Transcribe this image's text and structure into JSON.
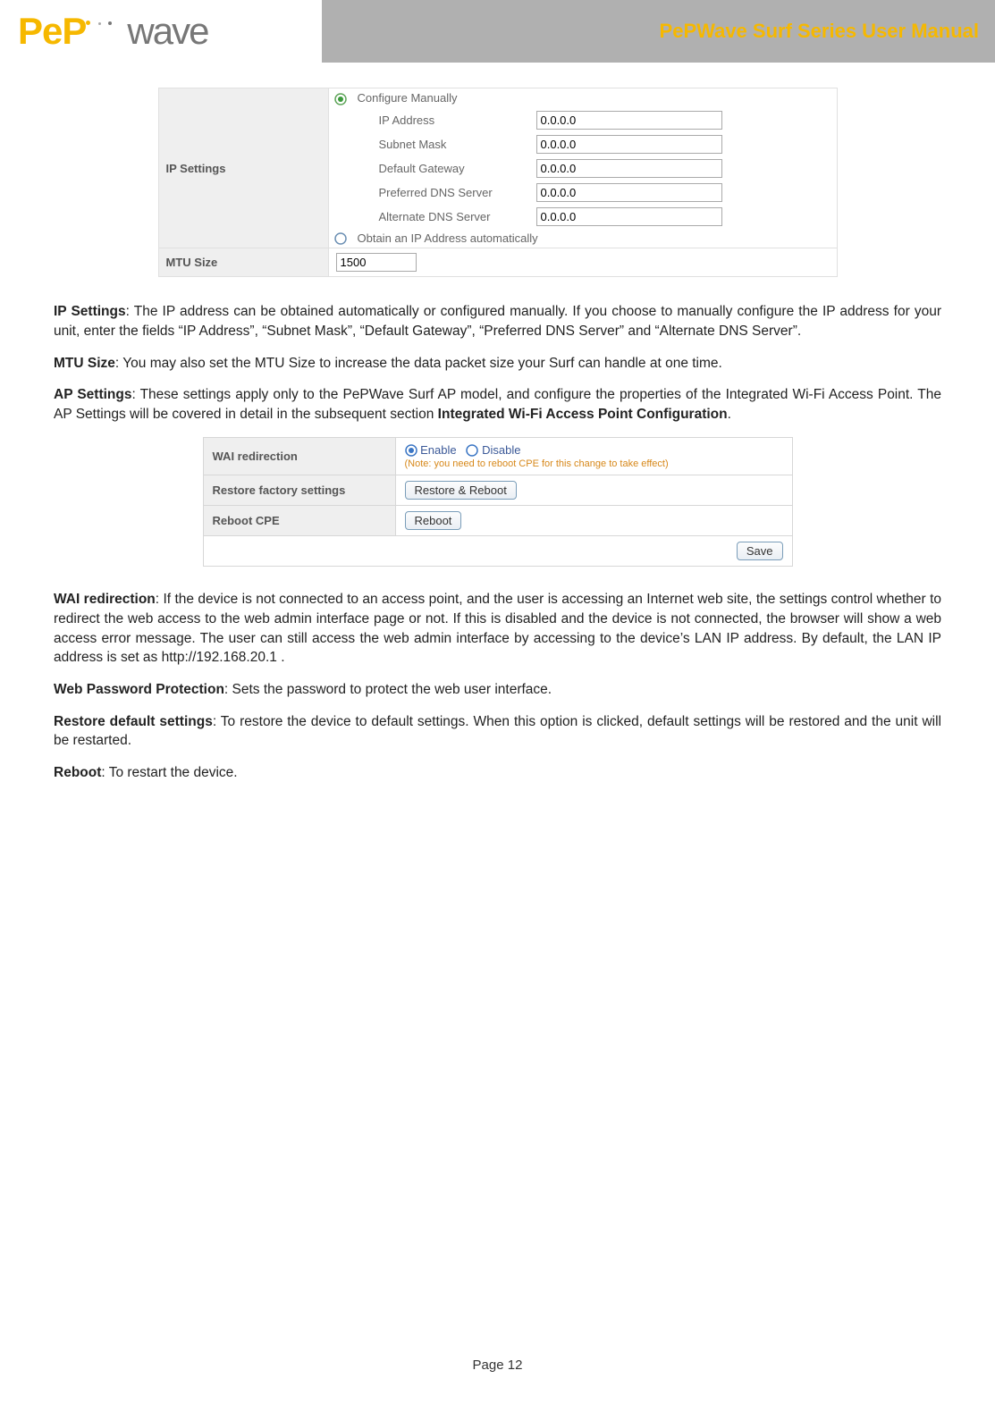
{
  "header": {
    "logo_pep": "PeP",
    "logo_wave": "wave",
    "title": "PePWave Surf Series User Manual"
  },
  "ip_settings": {
    "row_label": "IP Settings",
    "radio_manual": "Configure Manually",
    "radio_auto": "Obtain an IP Address automatically",
    "fields": {
      "ip_address": {
        "label": "IP Address",
        "value": "0.0.0.0"
      },
      "subnet_mask": {
        "label": "Subnet Mask",
        "value": "0.0.0.0"
      },
      "default_gateway": {
        "label": "Default Gateway",
        "value": "0.0.0.0"
      },
      "preferred_dns": {
        "label": "Preferred DNS Server",
        "value": "0.0.0.0"
      },
      "alternate_dns": {
        "label": "Alternate DNS Server",
        "value": "0.0.0.0"
      }
    }
  },
  "mtu": {
    "row_label": "MTU Size",
    "value": "1500"
  },
  "paragraphs": {
    "p1_bold": "IP Settings",
    "p1_text": ": The IP address can be obtained automatically or configured manually.  If you choose to manually configure the IP address for your unit, enter the fields “IP Address”, “Subnet Mask”, “Default Gateway”, “Preferred DNS Server” and “Alternate DNS Server”.",
    "p2_bold": "MTU Size",
    "p2_text": ": You may also set the MTU Size to increase the data packet size your Surf can handle at one time.",
    "p3_bold": "AP Settings",
    "p3_text": ":  These settings apply only to the PePWave Surf AP model, and configure the properties of the Integrated Wi-Fi Access Point.  The AP Settings will be covered in detail in the subsequent section ",
    "p3_bold2": "Integrated Wi-Fi Access Point Configuration",
    "p3_suffix": "."
  },
  "sys_table": {
    "wai": {
      "label": "WAI redirection",
      "enable": "Enable",
      "disable": "Disable",
      "note": "(Note: you need to reboot CPE for this change to take effect)"
    },
    "restore": {
      "label": "Restore factory settings",
      "button": "Restore & Reboot"
    },
    "reboot": {
      "label": "Reboot CPE",
      "button": "Reboot"
    },
    "save": "Save"
  },
  "paragraphs2": {
    "p4_bold": "WAI redirection",
    "p4_text": ": If the device is not connected to an access point, and the user is accessing an Internet web site, the settings control whether to redirect the web access to the web admin interface page or not.  If this is disabled and the device is not connected, the browser will show a web access error message.  The user can still access the web admin interface by accessing to the device’s LAN IP address.  By default, the LAN IP address is set as http://192.168.20.1 .",
    "p5_bold": "Web Password Protection",
    "p5_text": ":  Sets the password to protect the web user interface.",
    "p6_bold": "Restore default settings",
    "p6_text": ": To restore the device to default settings.  When this option is clicked, default settings will be restored and the unit will be restarted.",
    "p7_bold": "Reboot",
    "p7_text": ": To restart the device."
  },
  "footer": {
    "page": "Page 12"
  }
}
